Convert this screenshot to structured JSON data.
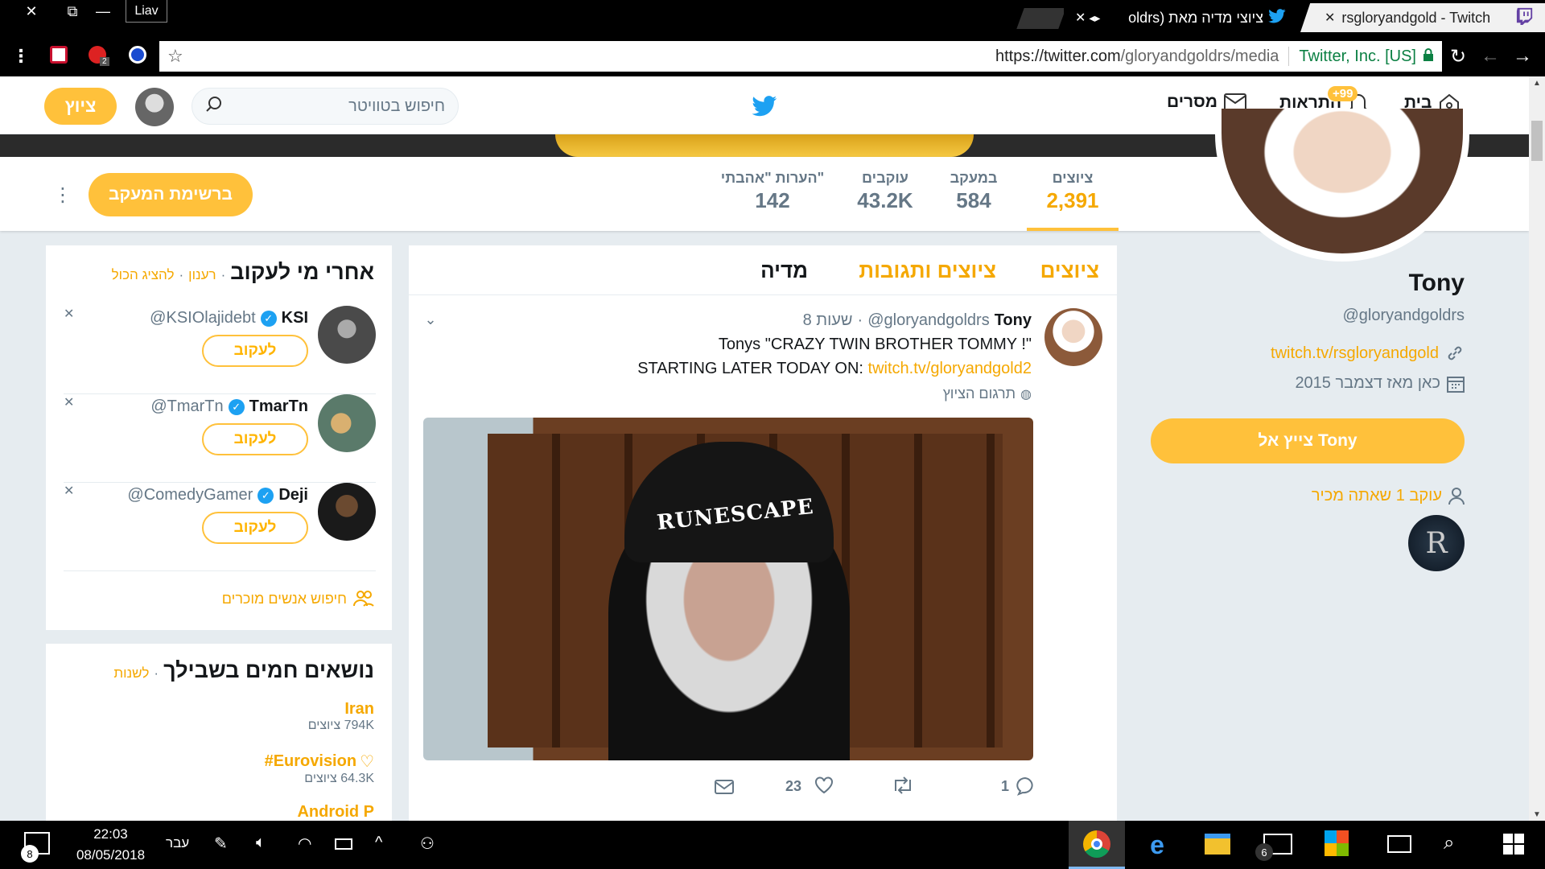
{
  "window": {
    "close_label": "✕",
    "restore_label": "⧉",
    "minimize_label": "—",
    "profile_label": "Liav"
  },
  "tabs": [
    {
      "title": "rsgloryandgold - Twitch",
      "close": "✕"
    },
    {
      "title": "ציוצי מדיה מאת (oldrs",
      "close": "✕"
    }
  ],
  "address": {
    "url_prefix": "https://",
    "url_domain": "twitter.com",
    "url_path": "/gloryandgoldrs/media",
    "cert": "Twitter, Inc. [US]",
    "extension_badge": "2"
  },
  "nav": {
    "home": "בית",
    "notifications": "התראות",
    "notifications_badge": "+99",
    "messages": "מסרים",
    "search_placeholder": "חיפוש בטוויטר",
    "tweet_button": "ציוץ"
  },
  "profile": {
    "name": "Tony",
    "handle": "@gloryandgoldrs",
    "link": "twitch.tv/rsgloryandgold",
    "joined": "כאן מאז דצמבר 2015",
    "tweet_to_button": "צייץ אל Tony",
    "followed_by": "עוקב 1 שאתה מכיר"
  },
  "stats": [
    {
      "label": "ציוצים",
      "value": "2,391"
    },
    {
      "label": "במעקב",
      "value": "584"
    },
    {
      "label": "עוקבים",
      "value": "43.2K"
    },
    {
      "label": "הערות \"אהבתי\"",
      "value": "142"
    }
  ],
  "following_button": "ברשימת המעקב",
  "timeline_tabs": {
    "tweets": "ציוצים",
    "replies": "ציוצים ותגובות",
    "media": "מדיה"
  },
  "tweet": {
    "name": "Tony",
    "handle": "@gloryandgoldrs",
    "sep": "·",
    "time": "8 שעות",
    "line1": "Tonys \"CRAZY TWIN BROTHER TOMMY !\"",
    "line2_prefix": "STARTING LATER TODAY ON: ",
    "line2_link": "twitch.tv/gloryandgold2",
    "translate": "תרגום הציוץ",
    "replies": "1",
    "retweets": "",
    "likes": "23",
    "media_text": "RUNESCAPE"
  },
  "who_to_follow": {
    "title": "אחרי מי לעקוב",
    "refresh": "רענון",
    "view_all": "להציג הכול",
    "sep": "·",
    "follow_label": "לעקוב",
    "dismiss": "✕",
    "users": [
      {
        "name": "KSI",
        "handle": "@KSIOlajidebt"
      },
      {
        "name": "TmarTn",
        "handle": "@TmarTn"
      },
      {
        "name": "Deji",
        "handle": "@ComedyGamer"
      }
    ],
    "find_people": "חיפוש אנשים מוכרים"
  },
  "trends": {
    "title": "נושאים חמים בשבילך",
    "change": "לשנות",
    "sep": "·",
    "items": [
      {
        "name": "Iran",
        "count": "794K ציוצים"
      },
      {
        "name": "#Eurovision",
        "count": "64.3K ציוצים"
      },
      {
        "name": "Android P",
        "count": ""
      }
    ]
  },
  "taskbar": {
    "time": "22:03",
    "date": "08/05/2018",
    "lang": "עבר",
    "notif_count": "8",
    "mail_count": "6"
  },
  "colors": {
    "accent": "#ffc13b",
    "twitter_blue": "#1da1f2",
    "verified": "#1da1f2",
    "page_bg": "#e6ecf0"
  }
}
